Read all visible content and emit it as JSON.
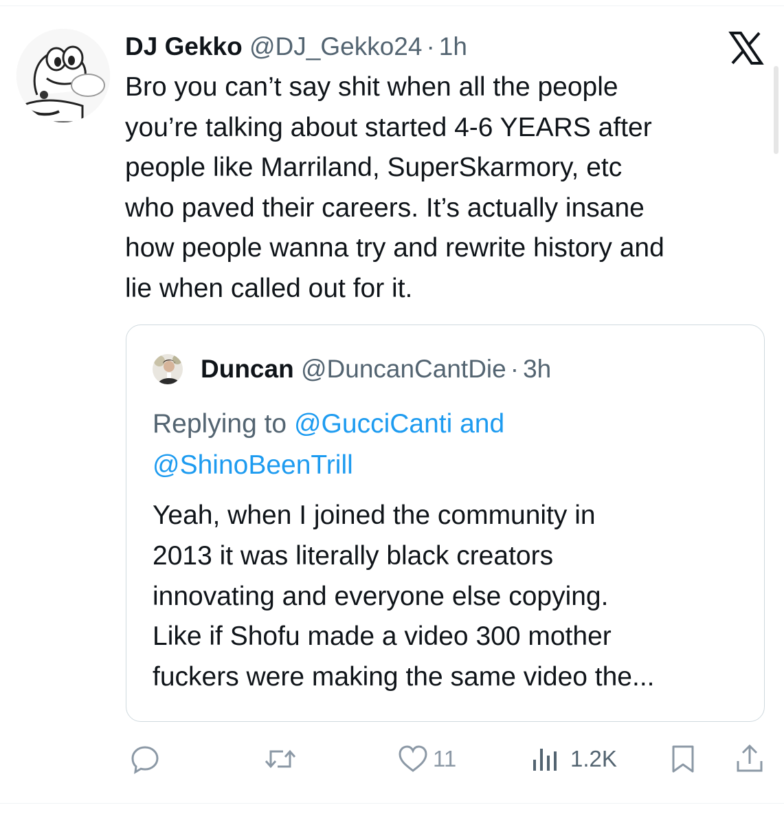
{
  "tweet": {
    "author_name": "DJ Gekko",
    "author_handle": "@DJ_Gekko24",
    "separator": "·",
    "time": "1h",
    "text": "Bro you can’t say shit when all the people\nyou’re talking about started 4-6 YEARS after\npeople like Marriland, SuperSkarmory, etc\nwho paved their careers.  It’s actually insane\nhow people wanna try and rewrite history and\nlie when called out for it."
  },
  "quote": {
    "author_name": "Duncan",
    "author_handle": "@DuncanCantDie",
    "separator": "·",
    "time": "3h",
    "replying_prefix": "Replying to ",
    "replying_mention_1": "@GucciCanti",
    "replying_and": " and",
    "replying_mention_2": "@ShinoBeenTrill",
    "text": "Yeah, when I joined the community in\n2013 it was literally black creators\ninnovating and everyone else copying.\nLike if Shofu made a video 300 mother\nfuckers were making the same video the..."
  },
  "actions": {
    "reply_count": "",
    "retweet_count": "",
    "like_count": "11",
    "views_count": "1.2K"
  },
  "icons": {
    "logo": "x-logo",
    "reply": "reply-icon",
    "retweet": "retweet-icon",
    "like": "heart-icon",
    "views": "views-icon",
    "bookmark": "bookmark-icon",
    "share": "share-icon"
  },
  "colors": {
    "text": "#0f1419",
    "secondary": "#536471",
    "link": "#1d9bf0",
    "border": "#cfd9de",
    "icon": "#8b98a5"
  }
}
